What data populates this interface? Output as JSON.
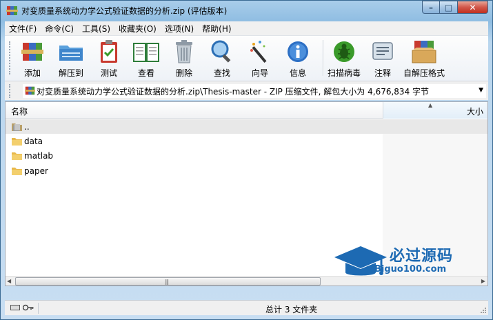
{
  "window": {
    "title": "对变质量系统动力学公式验证数据的分析.zip (评估版本)"
  },
  "menu": [
    {
      "label": "文件(F)"
    },
    {
      "label": "命令(C)"
    },
    {
      "label": "工具(S)"
    },
    {
      "label": "收藏夹(O)"
    },
    {
      "label": "选项(N)"
    },
    {
      "label": "帮助(H)"
    }
  ],
  "toolbar": {
    "add": "添加",
    "extract_to": "解压到",
    "test": "测试",
    "view": "查看",
    "delete": "删除",
    "find": "查找",
    "wizard": "向导",
    "info": "信息",
    "virus_scan": "扫描病毒",
    "comment": "注释",
    "sfx": "自解压格式"
  },
  "address": {
    "path": "对变质量系统动力学公式验证数据的分析.zip\\Thesis-master - ZIP 压缩文件, 解包大小为 4,676,834 字节"
  },
  "columns": {
    "name": "名称",
    "size": "大小"
  },
  "files": [
    {
      "name": "..",
      "kind": "parent"
    },
    {
      "name": "data",
      "kind": "folder"
    },
    {
      "name": "matlab",
      "kind": "folder"
    },
    {
      "name": "paper",
      "kind": "folder"
    }
  ],
  "status": {
    "summary": "总计 3 文件夹"
  },
  "watermark": {
    "title": "必过源码",
    "site": "Biguo100.com"
  },
  "colors": {
    "folder": "#e8b84a",
    "watermark": "#1d6ab3"
  }
}
